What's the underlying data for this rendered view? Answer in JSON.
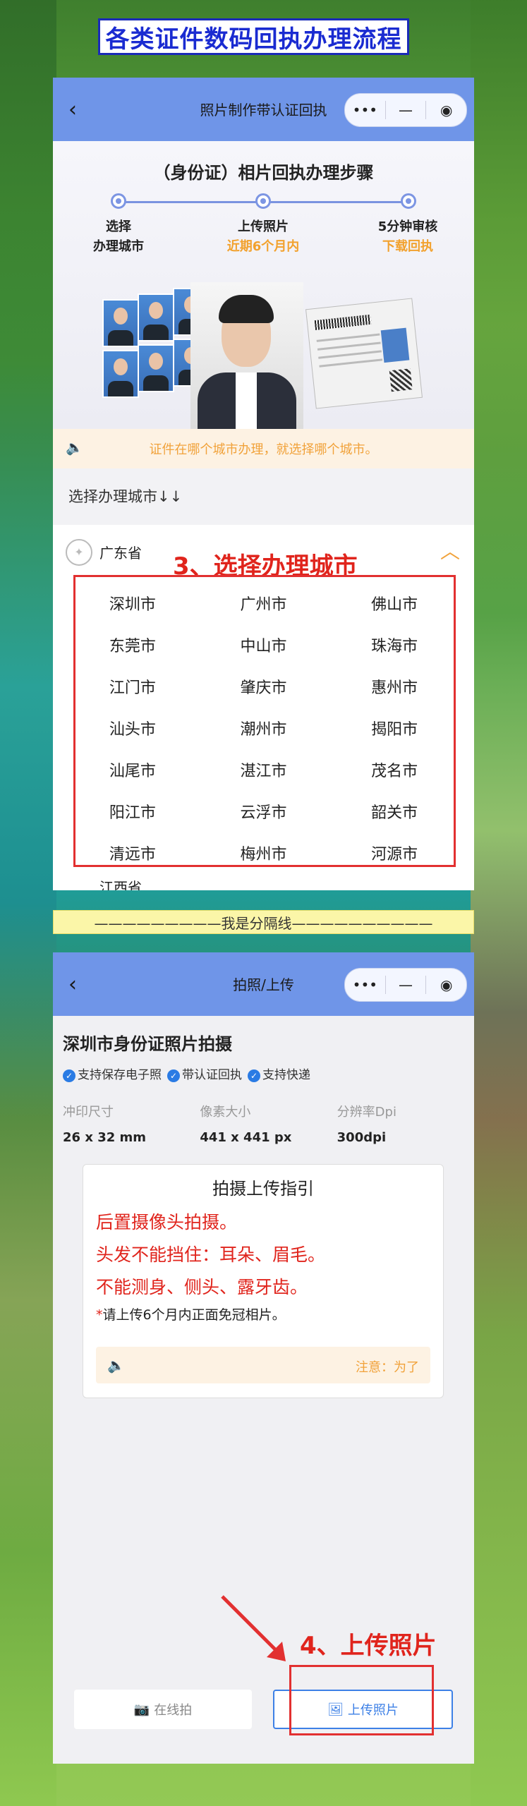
{
  "banner_title": "各类证件数码回执办理流程",
  "screen1": {
    "nav": {
      "back_icon": "‹",
      "title": "照片制作带认证回执",
      "capsule": [
        "•••",
        "—",
        "◉"
      ]
    },
    "steps": {
      "heading": "（身份证）相片回执办理步骤",
      "items": [
        {
          "line1": "选择",
          "line2": "办理城市",
          "highlight": false
        },
        {
          "line1": "上传照片",
          "line2": "近期6个月内",
          "highlight": true
        },
        {
          "line1": "5分钟审核",
          "line2": "下载回执",
          "highlight": true
        }
      ]
    },
    "notice": "证件在哪个城市办理，就选择哪个城市。",
    "select_label": "选择办理城市↓↓",
    "province": "广东省",
    "province_next": "江西省",
    "cities": [
      "深圳市",
      "广州市",
      "佛山市",
      "东莞市",
      "中山市",
      "珠海市",
      "江门市",
      "肇庆市",
      "惠州市",
      "汕头市",
      "潮州市",
      "揭阳市",
      "汕尾市",
      "湛江市",
      "茂名市",
      "阳江市",
      "云浮市",
      "韶关市",
      "清远市",
      "梅州市",
      "河源市"
    ],
    "annotation": "3、选择办理城市"
  },
  "divider_text": "—————————我是分隔线——————————",
  "screen2": {
    "nav": {
      "back_icon": "‹",
      "title": "拍照/上传",
      "capsule": [
        "•••",
        "—",
        "◉"
      ]
    },
    "title": "深圳市身份证照片拍摄",
    "badges": [
      "支持保存电子照",
      "带认证回执",
      "支持快递"
    ],
    "specs": [
      {
        "label": "冲印尺寸",
        "value": "26 x 32 mm"
      },
      {
        "label": "像素大小",
        "value": "441 x 441 px"
      },
      {
        "label": "分辨率Dpi",
        "value": "300dpi"
      }
    ],
    "guide": {
      "title": "拍摄上传指引",
      "lines": [
        "后置摄像头拍摄。",
        "头发不能挡住：耳朵、眉毛。",
        "不能测身、侧头、露牙齿。"
      ],
      "note_star": "*",
      "note": "请上传6个月内正面免冠相片。",
      "tip": "注意：为了"
    },
    "buttons": {
      "shoot": "在线拍",
      "upload": "上传照片"
    },
    "annotation": "4、上传照片"
  },
  "colors": {
    "accent": "#6f95e8",
    "warning": "#f1a23a",
    "annotation": "#e0241c",
    "link": "#3d80e6"
  }
}
